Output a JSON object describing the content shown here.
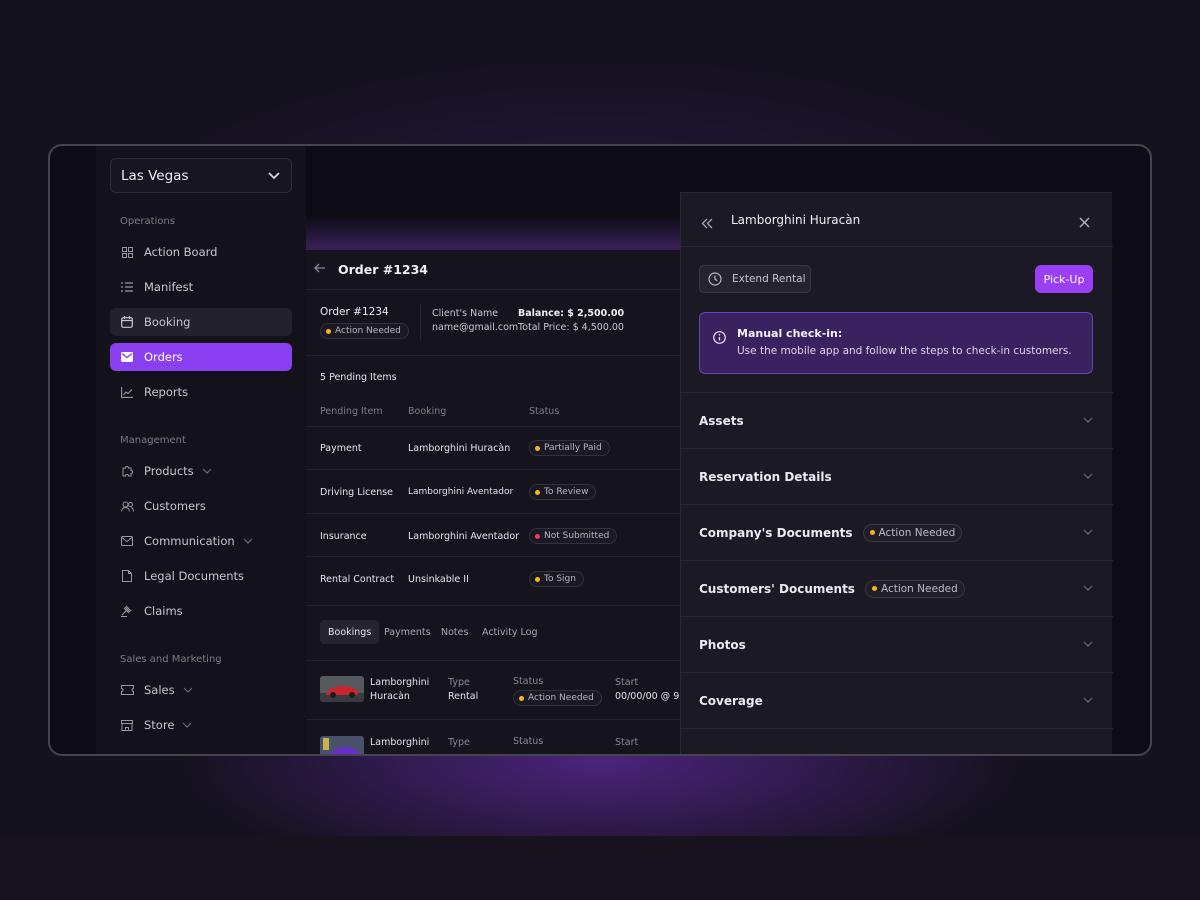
{
  "sidebar": {
    "location": "Las Vegas",
    "sections": [
      {
        "title": "Operations"
      },
      {
        "title": "Management"
      },
      {
        "title": "Sales and Marketing"
      }
    ],
    "items": {
      "action_board": "Action Board",
      "manifest": "Manifest",
      "booking": "Booking",
      "orders": "Orders",
      "reports": "Reports",
      "products": "Products",
      "customers": "Customers",
      "communication": "Communication",
      "legal_documents": "Legal Documents",
      "claims": "Claims",
      "sales": "Sales",
      "store": "Store"
    }
  },
  "order": {
    "header_title": "Order #1234",
    "order_number": "Order #1234",
    "order_status": "Action Needed",
    "client_name_label": "Client's Name",
    "client_email": "name@gmail.com",
    "balance": "Balance: $ 2,500.00",
    "total_price": "Total Price: $ 4,500.00",
    "pending_count": "5 Pending Items",
    "columns": [
      "Pending Item",
      "Booking",
      "Status"
    ],
    "pending_items": [
      {
        "item": "Payment",
        "booking": "Lamborghini Huracàn",
        "status": "Partially Paid",
        "color": "#f5b51c"
      },
      {
        "item": "Driving License",
        "booking": "Lamborghini Aventador",
        "status": "To Review",
        "color": "#f5b51c"
      },
      {
        "item": "Insurance",
        "booking": "Lamborghini Aventador",
        "status": "Not Submitted",
        "color": "#f0355a"
      },
      {
        "item": "Rental Contract",
        "booking": "Unsinkable II",
        "status": "To Sign",
        "color": "#f5b51c"
      }
    ],
    "tabs": [
      "Bookings",
      "Payments",
      "Notes",
      "Activity Log"
    ],
    "bookings": [
      {
        "name_line1": "Lamborghini",
        "name_line2": "Huracàn",
        "type_label": "Type",
        "type": "Rental",
        "status_label": "Status",
        "status": "Action Needed",
        "start_label": "Start",
        "start": "00/00/00 @ 9:"
      },
      {
        "name_line1": "Lamborghini",
        "name_line2": "",
        "type_label": "Type",
        "type": "",
        "status_label": "Status",
        "status": "",
        "start_label": "Start",
        "start": ""
      }
    ]
  },
  "drawer": {
    "title": "Lamborghini Huracàn",
    "extend_label": "Extend Rental",
    "pickup_label": "Pick-Up",
    "alert_title": "Manual check-in:",
    "alert_text": "Use the mobile app and follow the steps to check-in customers.",
    "sections": [
      {
        "label": "Assets",
        "badge": ""
      },
      {
        "label": "Reservation Details",
        "badge": ""
      },
      {
        "label": "Company's Documents",
        "badge": "Action Needed"
      },
      {
        "label": "Customers' Documents",
        "badge": "Action Needed"
      },
      {
        "label": "Photos",
        "badge": ""
      },
      {
        "label": "Coverage",
        "badge": ""
      }
    ]
  },
  "colors": {
    "accent": "#8a3ff0",
    "warning": "#f5b51c",
    "danger": "#f0355a"
  }
}
